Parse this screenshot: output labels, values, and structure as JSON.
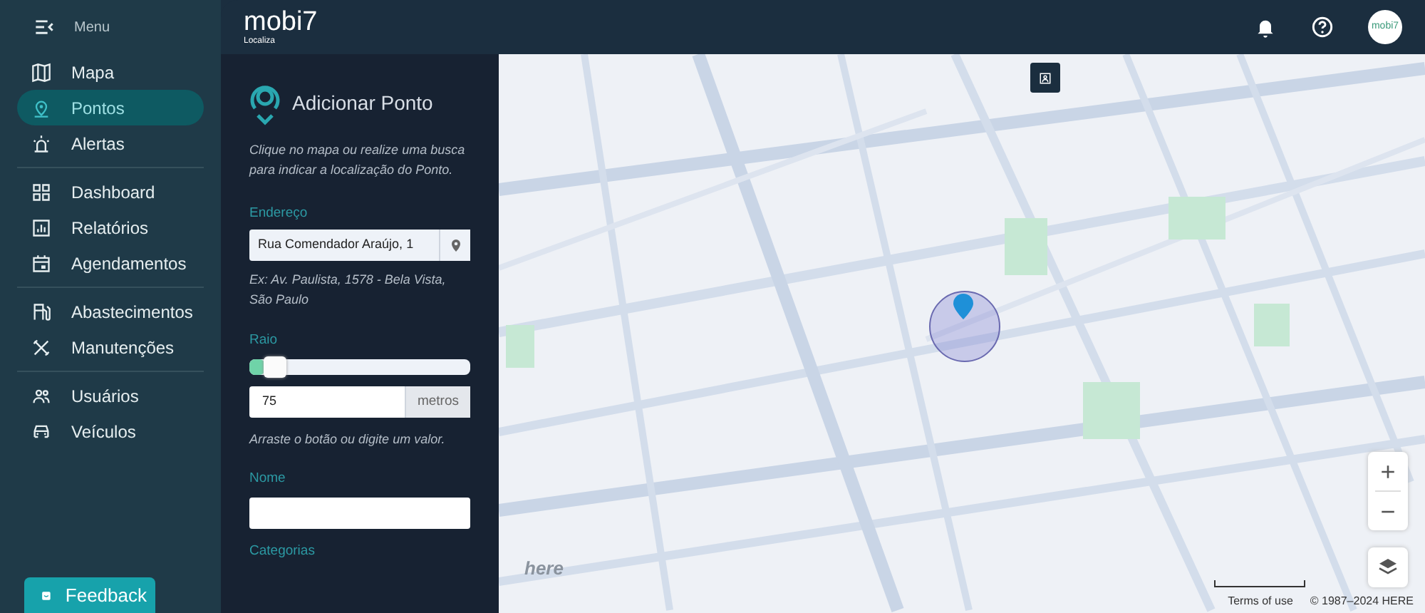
{
  "sidebar": {
    "menu_label": "Menu",
    "groups": [
      [
        {
          "label": "Mapa",
          "selected": false
        },
        {
          "label": "Pontos",
          "selected": true
        },
        {
          "label": "Alertas",
          "selected": false
        }
      ],
      [
        {
          "label": "Dashboard",
          "selected": false
        },
        {
          "label": "Relatórios",
          "selected": false
        },
        {
          "label": "Agendamentos",
          "selected": false
        }
      ],
      [
        {
          "label": "Abastecimentos",
          "selected": false
        },
        {
          "label": "Manutenções",
          "selected": false
        }
      ],
      [
        {
          "label": "Usuários",
          "selected": false
        },
        {
          "label": "Veículos",
          "selected": false
        }
      ]
    ],
    "feedback": "Feedback"
  },
  "topbar": {
    "logo": "mobi7",
    "logo_sub": "Localiza",
    "avatar_text": "mobi7"
  },
  "panel": {
    "title": "Adicionar Ponto",
    "intro": "Clique no mapa ou realize uma busca para indicar a localização do Ponto.",
    "address": {
      "label": "Endereço",
      "value": "Rua Comendador Araújo, 1",
      "hint": "Ex: Av. Paulista, 1578 - Bela Vista, São Paulo"
    },
    "radius": {
      "label": "Raio",
      "level": 0.07,
      "value": "75",
      "unit": "metros",
      "hint": "Arraste o botão ou digite um valor."
    },
    "name": {
      "label": "Nome"
    },
    "categories": {
      "label": "Categorias"
    }
  },
  "map": {
    "brand": "here",
    "terms": "Terms of use",
    "copyright": "© 1987–2024 HERE",
    "zoom_in": "+",
    "zoom_out": "−"
  }
}
